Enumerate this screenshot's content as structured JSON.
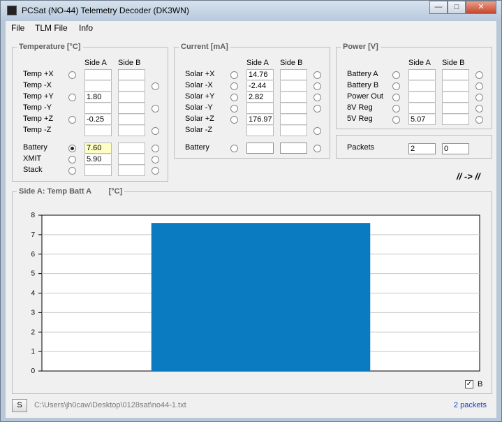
{
  "window": {
    "title": "PCSat (NO-44) Telemetry Decoder (DK3WN)",
    "controls": {
      "minimize": "—",
      "maximize": "□",
      "close": "✕"
    }
  },
  "menu": [
    "File",
    "TLM File",
    "Info"
  ],
  "temperature": {
    "title": "Temperature [°C]",
    "side_a": "Side A",
    "side_b": "Side B",
    "rows": [
      {
        "label": "Temp +X",
        "a": "",
        "b": ""
      },
      {
        "label": "Temp -X",
        "a": "",
        "b": ""
      },
      {
        "label": "Temp +Y",
        "a": "1.80",
        "b": ""
      },
      {
        "label": "Temp -Y",
        "a": "",
        "b": ""
      },
      {
        "label": "Temp +Z",
        "a": "-0.25",
        "b": ""
      },
      {
        "label": "Temp -Z",
        "a": "",
        "b": ""
      }
    ],
    "rows2": [
      {
        "label": "Battery",
        "a": "7.60",
        "b": ""
      },
      {
        "label": "XMIT",
        "a": "5.90",
        "b": ""
      },
      {
        "label": "Stack",
        "a": "",
        "b": ""
      }
    ]
  },
  "current": {
    "title": "Current [mA]",
    "side_a": "Side A",
    "side_b": "Side B",
    "rows": [
      {
        "label": "Solar +X",
        "a": "14.76",
        "b": ""
      },
      {
        "label": "Solar -X",
        "a": "-2.44",
        "b": ""
      },
      {
        "label": "Solar +Y",
        "a": "2.82",
        "b": ""
      },
      {
        "label": "Solar -Y",
        "a": "",
        "b": ""
      },
      {
        "label": "Solar +Z",
        "a": "176.97",
        "b": ""
      },
      {
        "label": "Solar -Z",
        "a": "",
        "b": ""
      }
    ],
    "battery": {
      "label": "Battery",
      "a": "",
      "b": ""
    }
  },
  "power": {
    "title": "Power [V]",
    "side_a": "Side A",
    "side_b": "Side B",
    "rows": [
      {
        "label": "Battery A",
        "a": "",
        "b": ""
      },
      {
        "label": "Battery B",
        "a": "",
        "b": ""
      },
      {
        "label": "Power Out",
        "a": "",
        "b": ""
      },
      {
        "label": "8V Reg",
        "a": "",
        "b": ""
      },
      {
        "label": "5V Reg",
        "a": "5.07",
        "b": ""
      }
    ]
  },
  "packets": {
    "label": "Packets",
    "a": "2",
    "b": "0"
  },
  "arrow": "// -> //",
  "chart_panel": {
    "title": "Side A: Temp Batt A",
    "unit": "[°C]",
    "checkbox_label": "B",
    "checkbox_mark": "✓"
  },
  "chart_data": {
    "type": "bar",
    "categories": [
      ""
    ],
    "values": [
      7.6
    ],
    "title": "",
    "xlabel": "",
    "ylabel": "",
    "ylim": [
      0,
      8
    ],
    "yticks": [
      "0",
      "1",
      "2",
      "3",
      "4",
      "5",
      "6",
      "7",
      "8"
    ],
    "grid": true,
    "colors": {
      "bar": "#0a7bc1",
      "grid": "#c8c8c8",
      "plot_bg": "#ffffff"
    }
  },
  "status": {
    "button": "S",
    "path": "C:\\Users\\jh0caw\\Desktop\\0128sat\\no44-1.txt",
    "packets": "2 packets"
  }
}
